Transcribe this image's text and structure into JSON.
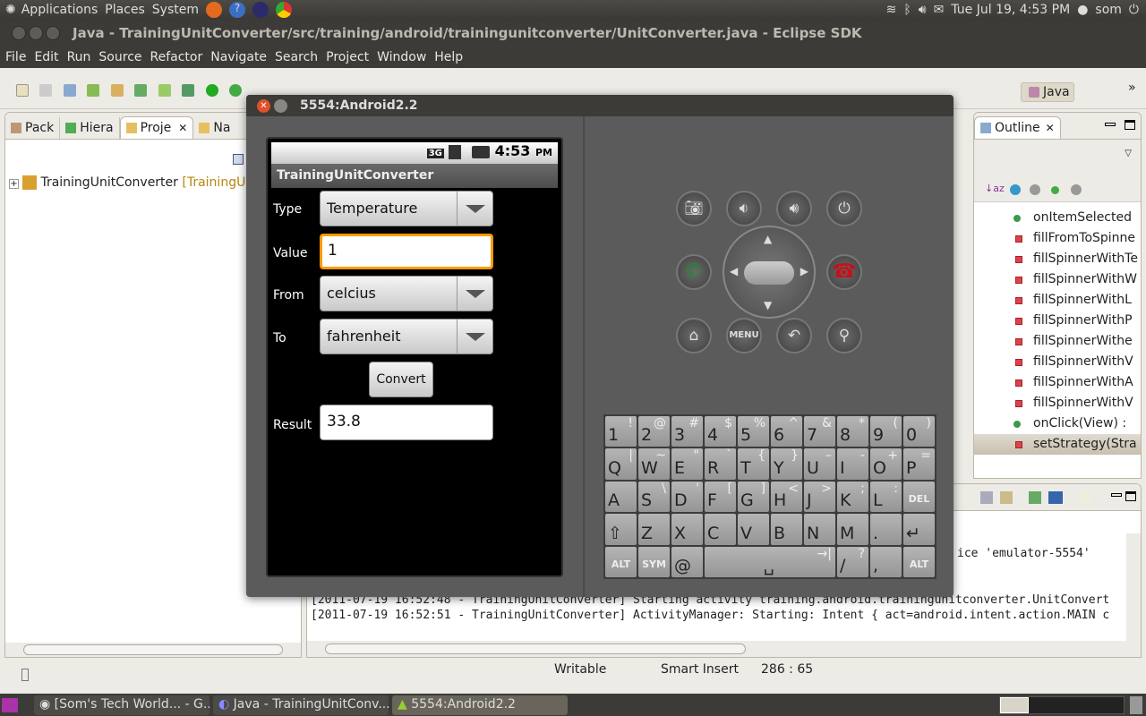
{
  "top_panel": {
    "menus": [
      "Applications",
      "Places",
      "System"
    ],
    "datetime": "Tue Jul 19,  4:53 PM",
    "user": "som"
  },
  "window": {
    "title": "Java - TrainingUnitConverter/src/training/android/trainingunitconverter/UnitConverter.java - Eclipse SDK"
  },
  "menubar": [
    "File",
    "Edit",
    "Run",
    "Source",
    "Refactor",
    "Navigate",
    "Search",
    "Project",
    "Window",
    "Help"
  ],
  "perspective": {
    "label": "Java",
    "more": "»"
  },
  "left_panel": {
    "tabs": [
      "Pack",
      "Hiera",
      "Proje",
      "Na"
    ],
    "tree": [
      {
        "label": "TrainingUnitConverter",
        "decor": "[TrainingUnit"
      }
    ]
  },
  "outline": {
    "title": "Outline",
    "items": [
      {
        "label": "onItemSelected",
        "kind": "public"
      },
      {
        "label": "fillFromToSpinne",
        "kind": "private"
      },
      {
        "label": "fillSpinnerWithTe",
        "kind": "private"
      },
      {
        "label": "fillSpinnerWithW",
        "kind": "private"
      },
      {
        "label": "fillSpinnerWithL",
        "kind": "private"
      },
      {
        "label": "fillSpinnerWithP",
        "kind": "private"
      },
      {
        "label": "fillSpinnerWithe",
        "kind": "private"
      },
      {
        "label": "fillSpinnerWithV",
        "kind": "private"
      },
      {
        "label": "fillSpinnerWithA",
        "kind": "private"
      },
      {
        "label": "fillSpinnerWithV",
        "kind": "private"
      },
      {
        "label": "onClick(View) :",
        "kind": "public"
      },
      {
        "label": "setStrategy(Stra",
        "kind": "private",
        "selected": true
      }
    ]
  },
  "console": {
    "lines": [
      "ice 'emulator-5554'",
      "[2011-07-19 16:52:48 - TrainingUnitConverter] Starting activity training.android.trainingunitconverter.UnitConvert",
      "[2011-07-19 16:52:51 - TrainingUnitConverter] ActivityManager: Starting: Intent { act=android.intent.action.MAIN c"
    ]
  },
  "status_bar": {
    "writable": "Writable",
    "insert_mode": "Smart Insert",
    "position": "286 : 65"
  },
  "taskbar": [
    "[Som's Tech World... - G...",
    "Java - TrainingUnitConv...",
    "5554:Android2.2"
  ],
  "emulator": {
    "title": "5554:Android2.2",
    "status_time": "4:53",
    "status_ampm": "PM",
    "network": "3G",
    "app_title": "TrainingUnitConverter",
    "form": {
      "type_label": "Type",
      "type_value": "Temperature",
      "value_label": "Value",
      "value": "1",
      "from_label": "From",
      "from_value": "celcius",
      "to_label": "To",
      "to_value": "fahrenheit",
      "convert_label": "Convert",
      "result_label": "Result",
      "result_value": "33.8"
    },
    "menu_key": "MENU",
    "keyboard": [
      [
        [
          "1",
          "!"
        ],
        [
          "2",
          "@"
        ],
        [
          "3",
          "#"
        ],
        [
          "4",
          "$"
        ],
        [
          "5",
          "%"
        ],
        [
          "6",
          "^"
        ],
        [
          "7",
          "&"
        ],
        [
          "8",
          "*"
        ],
        [
          "9",
          "("
        ],
        [
          "0",
          ")"
        ]
      ],
      [
        [
          "Q",
          "|"
        ],
        [
          "W",
          "~"
        ],
        [
          "E",
          "\""
        ],
        [
          "R",
          "`"
        ],
        [
          "T",
          "{"
        ],
        [
          "Y",
          "}"
        ],
        [
          "U",
          "–"
        ],
        [
          "I",
          "-"
        ],
        [
          "O",
          "+"
        ],
        [
          "P",
          "="
        ]
      ],
      [
        [
          "A",
          ""
        ],
        [
          "S",
          "\\"
        ],
        [
          "D",
          "'"
        ],
        [
          "F",
          "["
        ],
        [
          "G",
          "]"
        ],
        [
          "H",
          "<"
        ],
        [
          "J",
          ">"
        ],
        [
          "K",
          ";"
        ],
        [
          "L",
          ":"
        ],
        [
          "DEL",
          ""
        ]
      ],
      [
        [
          "⇧",
          ""
        ],
        [
          "Z",
          ""
        ],
        [
          "X",
          ""
        ],
        [
          "C",
          ""
        ],
        [
          "V",
          ""
        ],
        [
          "B",
          ""
        ],
        [
          "N",
          ""
        ],
        [
          "M",
          ""
        ],
        [
          ".",
          ""
        ],
        [
          "↵",
          ""
        ]
      ],
      [
        [
          "ALT",
          ""
        ],
        [
          "SYM",
          ""
        ],
        [
          "@",
          ""
        ],
        [
          "␣",
          "→|"
        ],
        [
          "/",
          "?"
        ],
        [
          ",",
          ""
        ],
        [
          "ALT",
          ""
        ]
      ]
    ]
  },
  "colors": {
    "focus_orange": "#ff9900",
    "panel_dark": "#3c3b37",
    "call_green": "#1e8c2e",
    "end_red": "#c0141c"
  }
}
